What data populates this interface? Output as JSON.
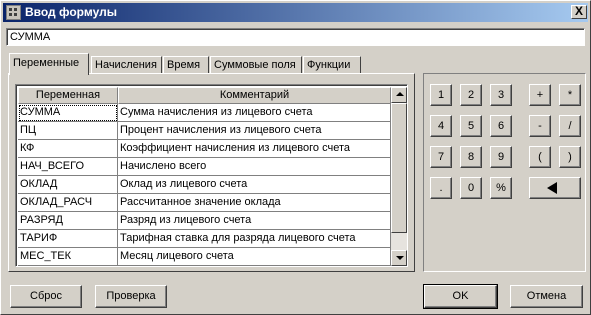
{
  "window": {
    "title": "Ввод формулы",
    "close_label": "X"
  },
  "formula": {
    "value": "СУММА"
  },
  "tabs": [
    {
      "label": "Переменные"
    },
    {
      "label": "Начисления"
    },
    {
      "label": "Время"
    },
    {
      "label": "Суммовые поля"
    },
    {
      "label": "Функции"
    }
  ],
  "grid": {
    "columns": [
      "Переменная",
      "Комментарий"
    ],
    "rows": [
      {
        "name": "СУММА",
        "comment": "Сумма начисления из лицевого счета"
      },
      {
        "name": "ПЦ",
        "comment": "Процент начисления из лицевого счета"
      },
      {
        "name": "КФ",
        "comment": "Коэффициент начисления из лицевого счета"
      },
      {
        "name": "НАЧ_ВСЕГО",
        "comment": "Начислено всего"
      },
      {
        "name": "ОКЛАД",
        "comment": "Оклад из лицевого счета"
      },
      {
        "name": "ОКЛАД_РАСЧ",
        "comment": "Рассчитанное значение оклада"
      },
      {
        "name": "РАЗРЯД",
        "comment": "Разряд из лицевого счета"
      },
      {
        "name": "ТАРИФ",
        "comment": "Тарифная ставка для разряда лицевого счета"
      },
      {
        "name": "МЕС_ТЕК",
        "comment": "Месяц лицевого счета"
      }
    ]
  },
  "keypad": {
    "keys": [
      "1",
      "2",
      "3",
      "+",
      "*",
      "4",
      "5",
      "6",
      "-",
      "/",
      "7",
      "8",
      "9",
      "(",
      ")",
      ".",
      "0",
      "%"
    ],
    "backspace_icon": "backspace-arrow-icon"
  },
  "buttons": {
    "reset": "Сброс",
    "check": "Проверка",
    "ok": "OK",
    "cancel": "Отмена"
  },
  "colors": {
    "titlebar_start": "#0a246a",
    "titlebar_end": "#a6caf0",
    "face": "#d4d0c8"
  }
}
